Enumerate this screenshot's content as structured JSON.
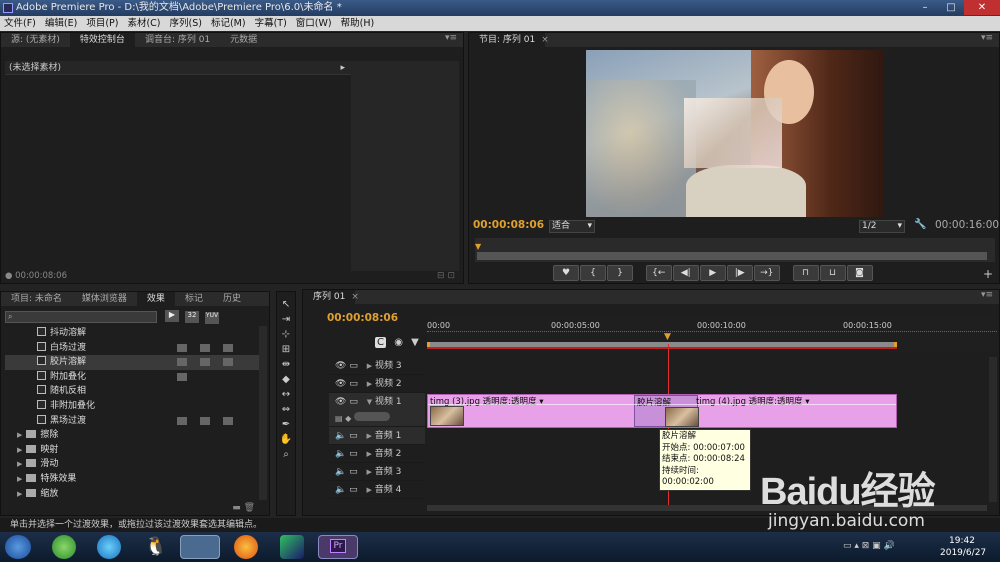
{
  "window": {
    "title": "Adobe Premiere Pro - D:\\我的文档\\Adobe\\Premiere Pro\\6.0\\未命名 *",
    "controls": [
      "minimize",
      "maximize",
      "close"
    ]
  },
  "menu": [
    "文件(F)",
    "编辑(E)",
    "项目(P)",
    "素材(C)",
    "序列(S)",
    "标记(M)",
    "字幕(T)",
    "窗口(W)",
    "帮助(H)"
  ],
  "source_panel": {
    "tabs": [
      "源: (无素材)",
      "特效控制台",
      "调音台: 序列 01",
      "元数据"
    ],
    "active_tab": 1,
    "header": "(未选择素材)",
    "timecode": "00:00:08:06"
  },
  "program_monitor": {
    "tab": "节目: 序列 01",
    "current_time": "00:00:08:06",
    "fit": "适合",
    "resolution": "1/2",
    "duration": "00:00:16:00"
  },
  "project_panel": {
    "tabs": [
      "项目: 未命名",
      "媒体浏览器",
      "效果",
      "标记",
      "历史"
    ],
    "active_tab": 2,
    "search_placeholder": "",
    "filter_buttons": [
      "32",
      "YUV"
    ],
    "effects": [
      {
        "label": "抖动溶解",
        "badges": 0
      },
      {
        "label": "白场过渡",
        "badges": 3
      },
      {
        "label": "胶片溶解",
        "badges": 3,
        "selected": true
      },
      {
        "label": "附加叠化",
        "badges": 1
      },
      {
        "label": "随机反相",
        "badges": 0
      },
      {
        "label": "非附加叠化",
        "badges": 0
      },
      {
        "label": "黑场过渡",
        "badges": 3
      }
    ],
    "folders": [
      "擦除",
      "映射",
      "滑动",
      "特殊效果",
      "缩放"
    ]
  },
  "timeline": {
    "tab": "序列 01",
    "current_time": "00:00:08:06",
    "ruler": [
      "00:00",
      "00:00:05:00",
      "00:00:10:00",
      "00:00:15:00"
    ],
    "video_tracks": [
      "视频 3",
      "视频 2",
      "视频 1"
    ],
    "audio_tracks": [
      "音频 1",
      "音频 2",
      "音频 3",
      "音频 4"
    ],
    "clips": [
      {
        "name": "timg (3).jpg",
        "fx": "透明度:透明度"
      },
      {
        "name": "timg (4).jpg",
        "fx": "透明度:透明度"
      }
    ],
    "transition": "胶片溶解",
    "tooltip": {
      "title": "胶片溶解",
      "start": "开始点: 00:00:07:00",
      "end": "结束点: 00:00:08:24",
      "duration": "持续时间: 00:00:02:00"
    }
  },
  "status_bar": "单击并选择一个过渡效果，或拖拉过该过渡效果套选其编辑点。",
  "taskbar": {
    "time": "19:42",
    "date": "2019/6/27",
    "apps": [
      "start",
      "360-browser",
      "windmill",
      "qq",
      "explorer",
      "firefox",
      "media-app",
      "premiere"
    ]
  },
  "watermark": {
    "brand": "Baidu经验",
    "url": "jingyan.baidu.com"
  },
  "colors": {
    "accent": "#e0a030",
    "clip": "#e080e0",
    "timecode": "#e0a030",
    "playhead": "#e03030"
  }
}
